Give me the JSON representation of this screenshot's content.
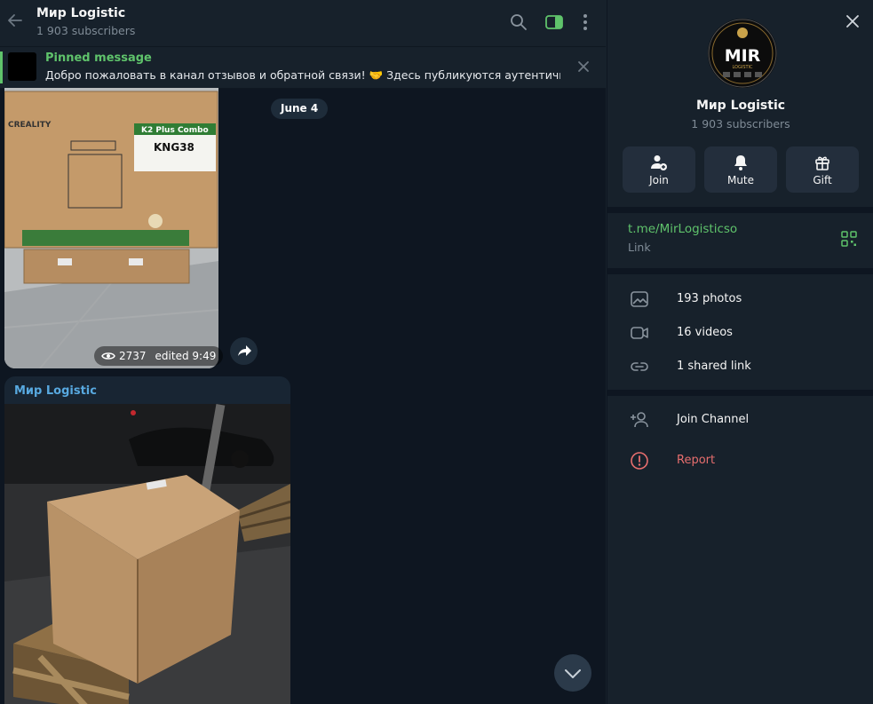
{
  "header": {
    "title": "Мир Logistic",
    "subtitle": "1 903 subscribers"
  },
  "pinned": {
    "title": "Pinned message",
    "text": "Добро пожаловать в канал отзывов и обратной связи! 🤝 Здесь публикуются аутентичн..."
  },
  "date_pill": "June 4",
  "message1": {
    "views": "2737",
    "edited": "edited 9:49",
    "box": {
      "brand": "CREALITY",
      "label": "K2 Plus Combo",
      "code": "KNG38"
    }
  },
  "message2": {
    "author": "Мир Logistic"
  },
  "panel": {
    "avatar_text": "MIR",
    "avatar_sub": "LOGISTIC",
    "title": "Мир Logistic",
    "subtitle": "1 903 subscribers",
    "actions": [
      {
        "label": "Join"
      },
      {
        "label": "Mute"
      },
      {
        "label": "Gift"
      }
    ],
    "link": {
      "url": "t.me/MirLogisticso",
      "label": "Link"
    },
    "media": [
      {
        "label": "193 photos"
      },
      {
        "label": "16 videos"
      },
      {
        "label": "1 shared link"
      }
    ],
    "join_channel": "Join Channel",
    "report": "Report"
  },
  "colors": {
    "accent_green": "#5fc36b",
    "report_red": "#e76e6e",
    "author_blue": "#58a9e0",
    "panel_bg": "#17212b",
    "chat_bg": "#0e1621"
  }
}
